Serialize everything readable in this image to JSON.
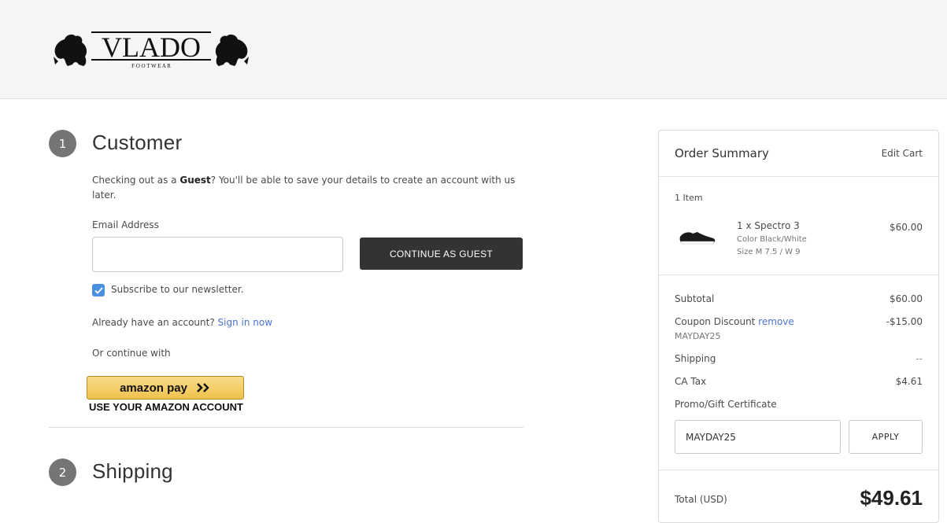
{
  "header": {
    "logo_text": "VLADO",
    "logo_subtext": "F O O T W E A R"
  },
  "customer": {
    "step_number": "1",
    "title": "Customer",
    "guest_text_prefix": "Checking out as a ",
    "guest_bold": "Guest",
    "guest_text_suffix": "? You'll be able to save your details to create an account with us",
    "guest_text_line2": "later.",
    "email_label": "Email Address",
    "email_value": "",
    "continue_button": "CONTINUE AS GUEST",
    "newsletter_label": "Subscribe to our newsletter.",
    "newsletter_checked": true,
    "account_prompt": "Already have an account?",
    "sign_in_link": "Sign in now",
    "or_continue": "Or continue with",
    "amazon_pay_label": "amazon pay",
    "amazon_caption": "USE YOUR AMAZON ACCOUNT"
  },
  "shipping": {
    "step_number": "2",
    "title": "Shipping"
  },
  "summary": {
    "title": "Order Summary",
    "edit_cart": "Edit Cart",
    "item_count": "1 Item",
    "item": {
      "name": "1 x Spectro 3",
      "color": "Color Black/White",
      "size": "Size M 7.5 / W 9",
      "price": "$60.00"
    },
    "subtotal_label": "Subtotal",
    "subtotal_value": "$60.00",
    "coupon_label": "Coupon Discount",
    "coupon_remove": "remove",
    "coupon_code": "MAYDAY25",
    "coupon_value": "-$15.00",
    "shipping_label": "Shipping",
    "shipping_value": "--",
    "tax_label": "CA Tax",
    "tax_value": "$4.61",
    "promo_link": "Promo/Gift Certificate",
    "promo_input_value": "MAYDAY25",
    "apply_button": "APPLY",
    "total_label": "Total (USD)",
    "total_value": "$49.61"
  },
  "colors": {
    "accent_link": "#4b71cf",
    "dark_button": "#333333",
    "checkbox": "#4b8fdf",
    "amazon_gold": "#f0c24d"
  }
}
